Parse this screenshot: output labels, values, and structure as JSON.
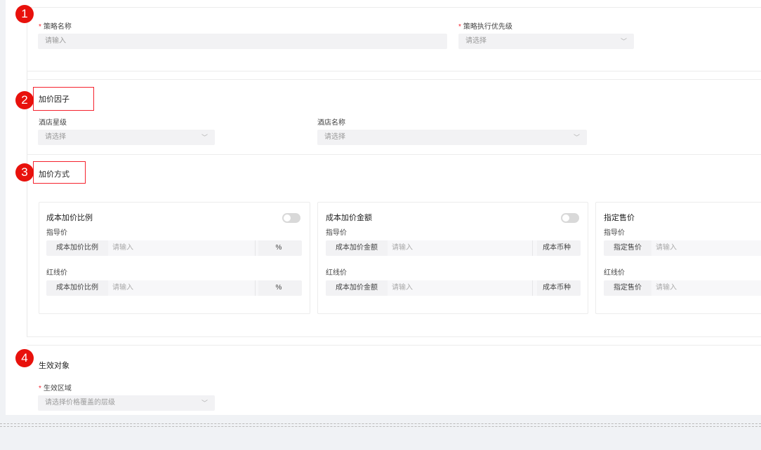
{
  "badges": [
    "1",
    "2",
    "3",
    "4"
  ],
  "basic": {
    "strategy_name_label": "策略名称",
    "strategy_name_placeholder": "请输入",
    "priority_label": "策略执行优先级",
    "priority_placeholder": "请选择",
    "required_mark": "*"
  },
  "factor": {
    "title": "加价因子",
    "hotel_star_label": "酒店星级",
    "hotel_star_placeholder": "请选择",
    "hotel_name_label": "酒店名称",
    "hotel_name_placeholder": "请选择"
  },
  "method": {
    "title": "加价方式",
    "cards": [
      {
        "title": "成本加价比例",
        "guide_label": "指导价",
        "red_label": "红线价",
        "addon_left": "成本加价比例",
        "placeholder": "请输入",
        "addon_right": "%"
      },
      {
        "title": "成本加价金额",
        "guide_label": "指导价",
        "red_label": "红线价",
        "addon_left": "成本加价金额",
        "placeholder": "请输入",
        "addon_right": "成本币种"
      },
      {
        "title": "指定售价",
        "guide_label": "指导价",
        "red_label": "红线价",
        "addon_left": "指定售价",
        "placeholder": "请输入"
      }
    ]
  },
  "target": {
    "title": "生效对象",
    "region_label": "生效区域",
    "region_placeholder": "请选择价格覆盖的层级"
  },
  "icons": {
    "chevron": "chevron-down-icon"
  },
  "colors": {
    "badge": "#e8110c",
    "highlight_box": "#f5222d",
    "required": "#f5222d"
  }
}
